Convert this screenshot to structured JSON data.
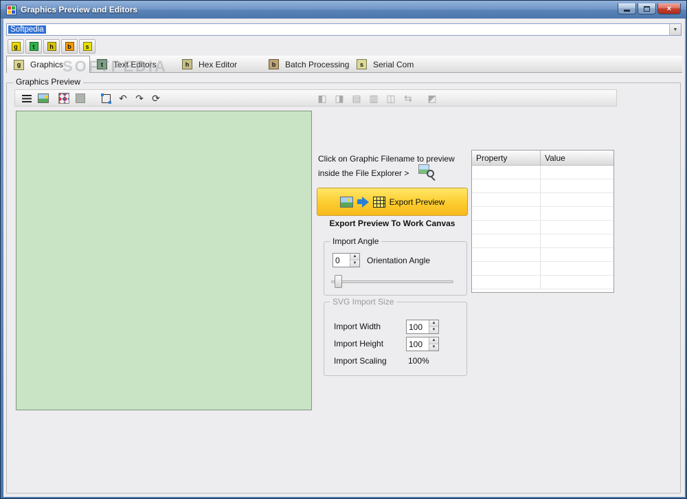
{
  "window": {
    "title": "Graphics Preview and Editors"
  },
  "titlebar": {
    "close_glyph": "×"
  },
  "filename_combo": {
    "value": "Softpedia"
  },
  "watermark": "SOFTPEDIA",
  "mini_tabs": [
    {
      "letter": "g",
      "color": "#ead900"
    },
    {
      "letter": "t",
      "color": "#2fb34d"
    },
    {
      "letter": "h",
      "color": "#d6c400"
    },
    {
      "letter": "b",
      "color": "#f59a00"
    },
    {
      "letter": "s",
      "color": "#e6e000"
    }
  ],
  "tabs": [
    {
      "letter": "g",
      "label": "Graphics",
      "color": "#ead900"
    },
    {
      "letter": "t",
      "label": "Text Editors",
      "color": "#2fb34d"
    },
    {
      "letter": "h",
      "label": "Hex Editor",
      "color": "#d6c400"
    },
    {
      "letter": "b",
      "label": "Batch Processing",
      "color": "#f59a00"
    },
    {
      "letter": "s",
      "label": "Serial Com",
      "color": "#e6e000"
    }
  ],
  "frame_title": "Graphics Preview",
  "canvas": {
    "color": "#c9e3c5"
  },
  "preview_panel": {
    "hint_line1": "Click on Graphic Filename to preview",
    "hint_line2": "inside the File Explorer >",
    "export_button_label": "Export Preview",
    "export_caption": "Export Preview To Work Canvas"
  },
  "import_angle": {
    "group_title": "Import Angle",
    "angle_value": "0",
    "angle_label": "Orientation Angle"
  },
  "svg_import": {
    "group_title": "SVG Import Size",
    "width_label": "Import Width",
    "width_value": "100",
    "height_label": "Import Height",
    "height_value": "100",
    "scaling_label": "Import Scaling",
    "scaling_value": "100%"
  },
  "property_table": {
    "columns": [
      "Property",
      "Value"
    ]
  }
}
